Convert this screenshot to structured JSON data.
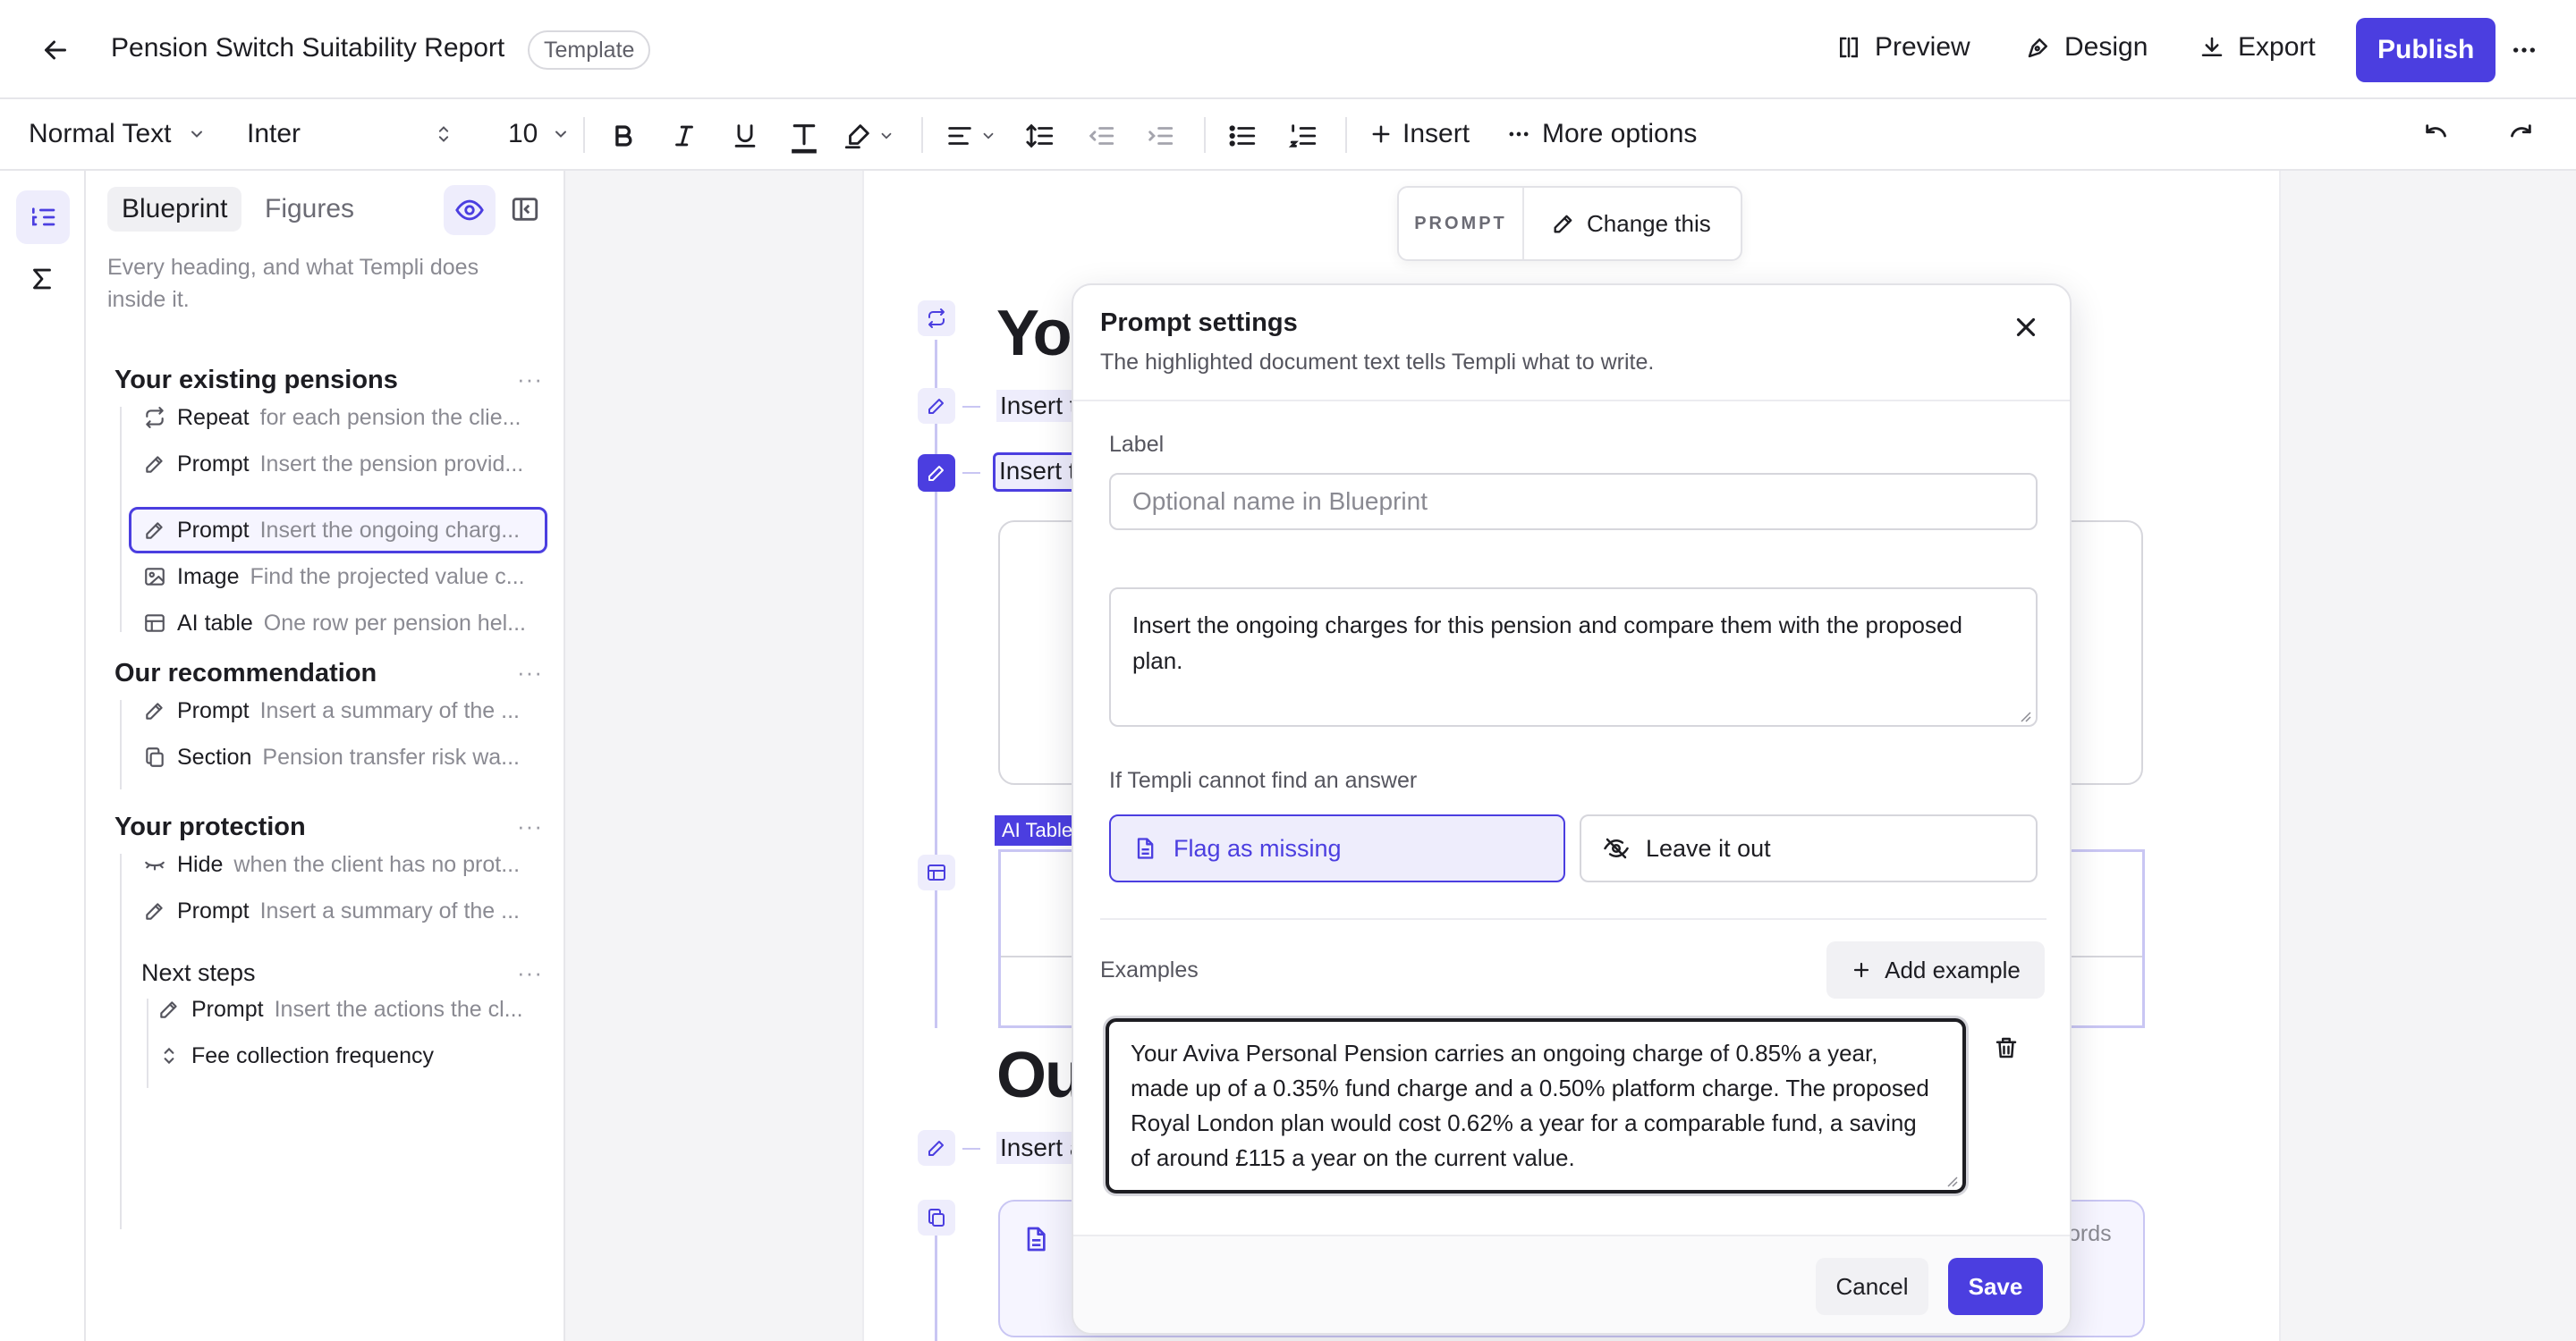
{
  "header": {
    "title": "Pension Switch Suitability Report",
    "badge": "Template",
    "preview_label": "Preview",
    "design_label": "Design",
    "export_label": "Export",
    "publish_label": "Publish"
  },
  "toolbar": {
    "text_style": "Normal Text",
    "font": "Inter",
    "font_size": "10",
    "insert_label": "Insert",
    "more_options_label": "More options"
  },
  "sidebar": {
    "tabs": [
      {
        "label": "Blueprint"
      },
      {
        "label": "Figures"
      }
    ],
    "subtitle": "Every heading, and what Templi does inside it.",
    "sections": [
      {
        "title": "Your existing pensions",
        "items": [
          {
            "kind": "Repeat",
            "desc": "for each pension the clie..."
          },
          {
            "kind": "Prompt",
            "desc": "Insert the pension provid..."
          },
          {
            "kind": "Prompt",
            "desc": "Insert the ongoing charg..."
          },
          {
            "kind": "Image",
            "desc": "Find the projected value c..."
          },
          {
            "kind": "AI table",
            "desc": "One row per pension hel..."
          }
        ]
      },
      {
        "title": "Our recommendation",
        "items": [
          {
            "kind": "Prompt",
            "desc": "Insert a summary of the ..."
          },
          {
            "kind": "Section",
            "desc": "Pension transfer risk wa..."
          }
        ]
      },
      {
        "title": "Your protection",
        "items": [
          {
            "kind": "Hide",
            "desc": "when the client has no prot..."
          },
          {
            "kind": "Prompt",
            "desc": "Insert a summary of the ..."
          }
        ]
      }
    ],
    "subsection": {
      "title": "Next steps",
      "items": [
        {
          "kind": "Prompt",
          "desc": "Insert the actions the cl..."
        },
        {
          "kind": "Fee collection frequency",
          "desc": ""
        }
      ]
    }
  },
  "document": {
    "heading1_partial": "You",
    "line1_partial": "Insert t",
    "line2_partial": "Insert t",
    "ai_table_label": "AI Table",
    "heading2_partial": "Ou",
    "line3_partial": "Insert a",
    "words_partial": "ords"
  },
  "prompt_chip": {
    "tag": "PROMPT",
    "change_label": "Change this"
  },
  "modal": {
    "title": "Prompt settings",
    "subtitle": "The highlighted document text tells Templi what to write.",
    "label_title": "Label",
    "label_placeholder": "Optional name in Blueprint",
    "prompt_text": "Insert the ongoing charges for this pension and compare them with the proposed plan.",
    "fallback_title": "If Templi cannot find an answer",
    "flag_label": "Flag as missing",
    "leave_label": "Leave it out",
    "examples_title": "Examples",
    "add_example_label": "Add example",
    "example_text": "Your Aviva Personal Pension carries an ongoing charge of 0.85% a year, made up of a 0.35% fund charge and a 0.50% platform charge. The proposed Royal London plan would cost 0.62% a year for a comparable fund, a saving of around £115 a year on the current value.",
    "cancel_label": "Cancel",
    "save_label": "Save"
  },
  "colors": {
    "accent": "#4b3ee0",
    "accent_soft": "#eeedfc",
    "border": "#e6e6ea"
  }
}
